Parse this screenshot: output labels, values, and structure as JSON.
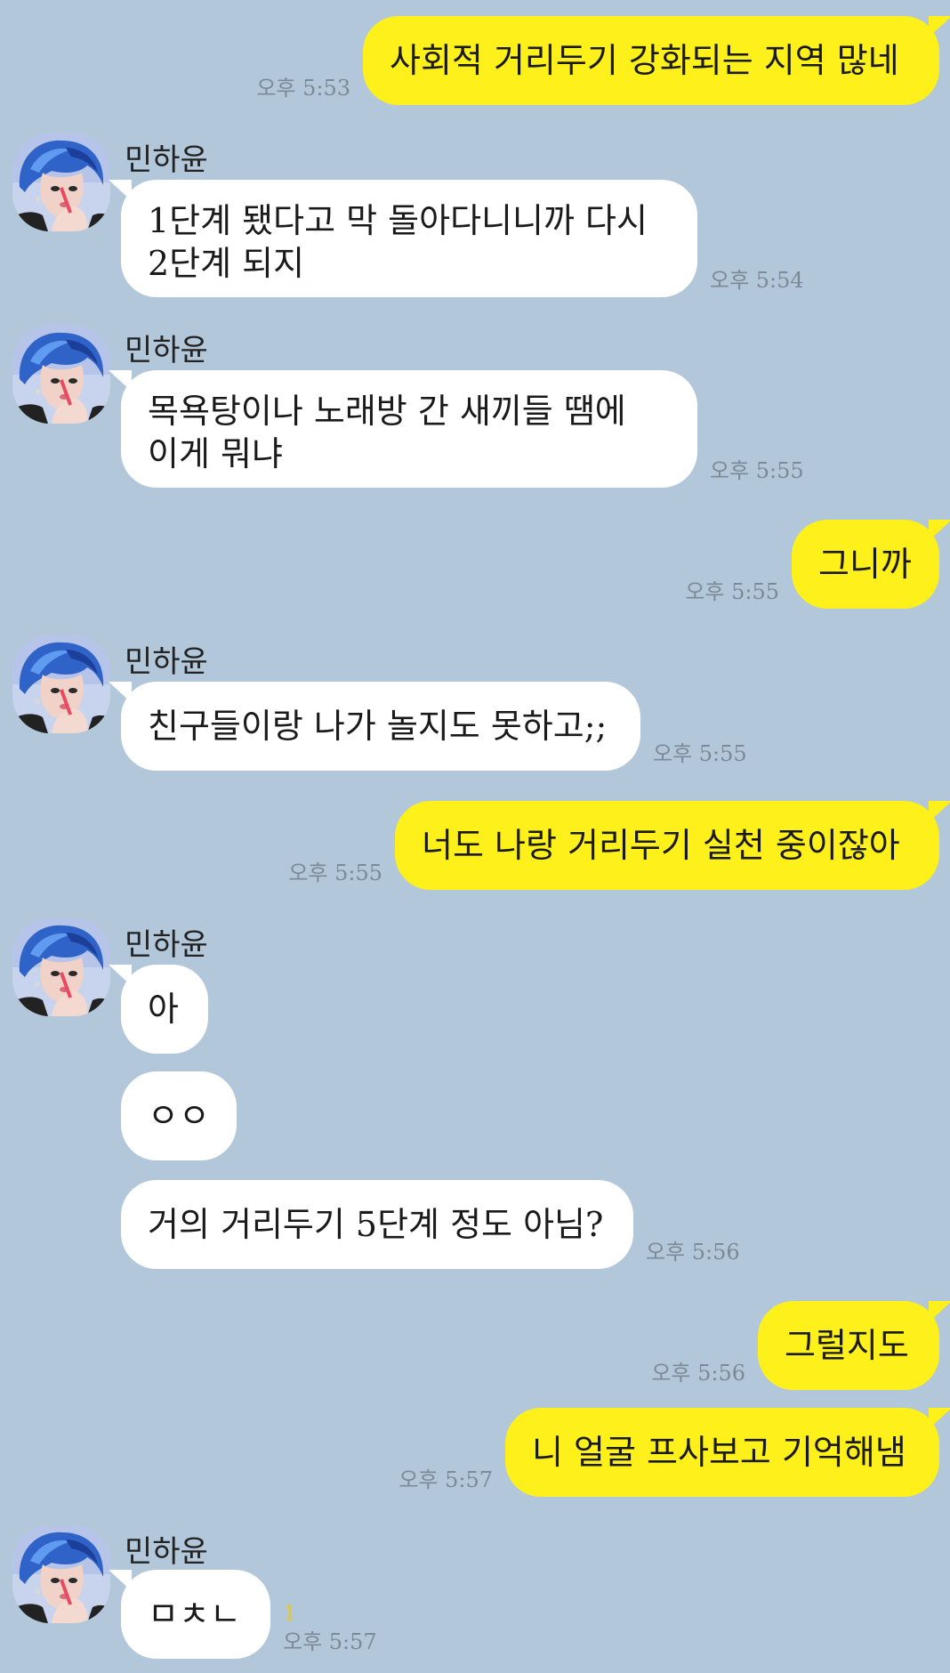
{
  "contact": {
    "name": "민하윤"
  },
  "messages": [
    {
      "from": "me",
      "text": "사회적 거리두기 강화되는 지역 많네",
      "time": "오후 5:53"
    },
    {
      "from": "them",
      "sender": "민하윤",
      "lines": [
        "1단계 됐다고 막 돌아다니니까 다시",
        "2단계 되지"
      ],
      "time": "오후 5:54"
    },
    {
      "from": "them",
      "sender": "민하윤",
      "lines": [
        "목욕탕이나 노래방 간 새끼들 땜에",
        "이게 뭐냐"
      ],
      "time": "오후 5:55"
    },
    {
      "from": "me",
      "text": "그니까",
      "time": "오후 5:55"
    },
    {
      "from": "them",
      "sender": "민하윤",
      "text": "친구들이랑 나가 놀지도 못하고;;",
      "time": "오후 5:55"
    },
    {
      "from": "me",
      "text": "너도 나랑 거리두기 실천 중이잖아",
      "time": "오후 5:55"
    },
    {
      "from": "them",
      "sender": "민하윤",
      "text": "아"
    },
    {
      "from": "them",
      "text": "ㅇㅇ"
    },
    {
      "from": "them",
      "text": "거의 거리두기 5단계 정도 아님?",
      "time": "오후 5:56"
    },
    {
      "from": "me",
      "text": "그럴지도",
      "time": "오후 5:56"
    },
    {
      "from": "me",
      "text": "니 얼굴 프사보고 기억해냄",
      "time": "오후 5:57"
    },
    {
      "from": "them",
      "sender": "민하윤",
      "text": "ㅁㅊㄴ",
      "time": "오후 5:57",
      "unread": "1"
    }
  ],
  "colors": {
    "background": "#b2c7d9",
    "sent_bubble": "#fef01b",
    "received_bubble": "#ffffff",
    "timestamp": "#7d8a96",
    "unread": "#e2c93a"
  },
  "icons": {
    "avatar": "profile-photo-blue-hair"
  }
}
